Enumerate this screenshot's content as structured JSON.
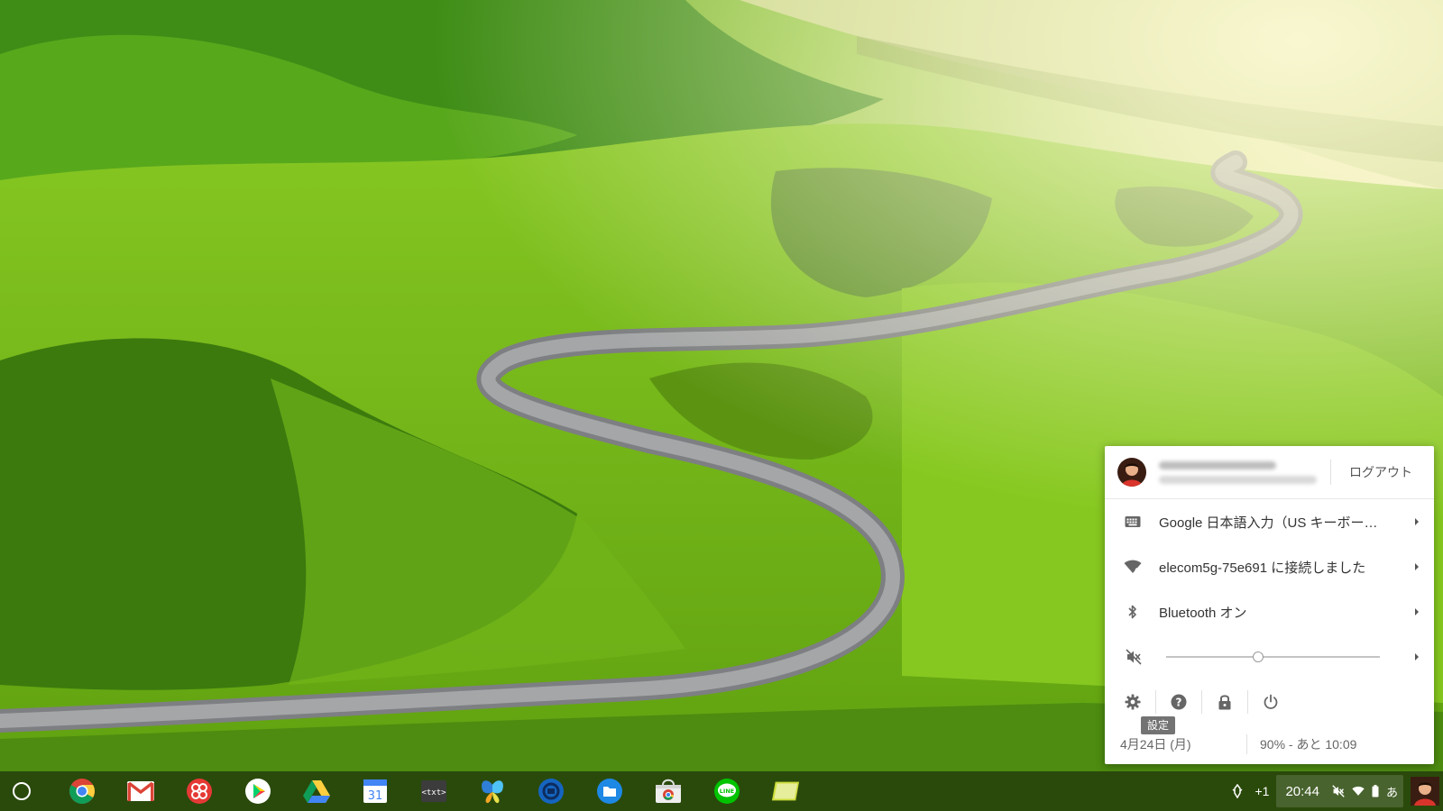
{
  "tray": {
    "logout_label": "ログアウト",
    "ime_label": "Google 日本語入力（US キーボー…",
    "network_label": "elecom5g-75e691 に接続しました",
    "bluetooth_label": "Bluetooth オン",
    "volume_level": 0.43,
    "settings_tooltip": "設定",
    "date": "4月24日 (月)",
    "battery": "90% - あと 10:09"
  },
  "shelf": {
    "apps": [
      {
        "name": "chrome-icon"
      },
      {
        "name": "gmail-icon"
      },
      {
        "name": "pinwheel-app-icon"
      },
      {
        "name": "play-store-icon"
      },
      {
        "name": "drive-icon"
      },
      {
        "name": "calendar-icon",
        "text": "31"
      },
      {
        "name": "text-editor-icon",
        "text": "<txt>"
      },
      {
        "name": "butterfly-app-icon"
      },
      {
        "name": "blue-circle-app-icon"
      },
      {
        "name": "files-icon"
      },
      {
        "name": "chrome-web-store-icon"
      },
      {
        "name": "line-icon",
        "text": "LINE"
      },
      {
        "name": "sticky-notes-icon"
      }
    ],
    "status": {
      "notification_count": "+1",
      "time": "20:44",
      "ime_indicator": "あ"
    }
  },
  "colors": {
    "shelf_bg": "#0f140a",
    "bubble_bg": "#ffffff",
    "sky_green": "#cfe089",
    "hill_green": "#7cc41e",
    "road": "#8f9092"
  }
}
